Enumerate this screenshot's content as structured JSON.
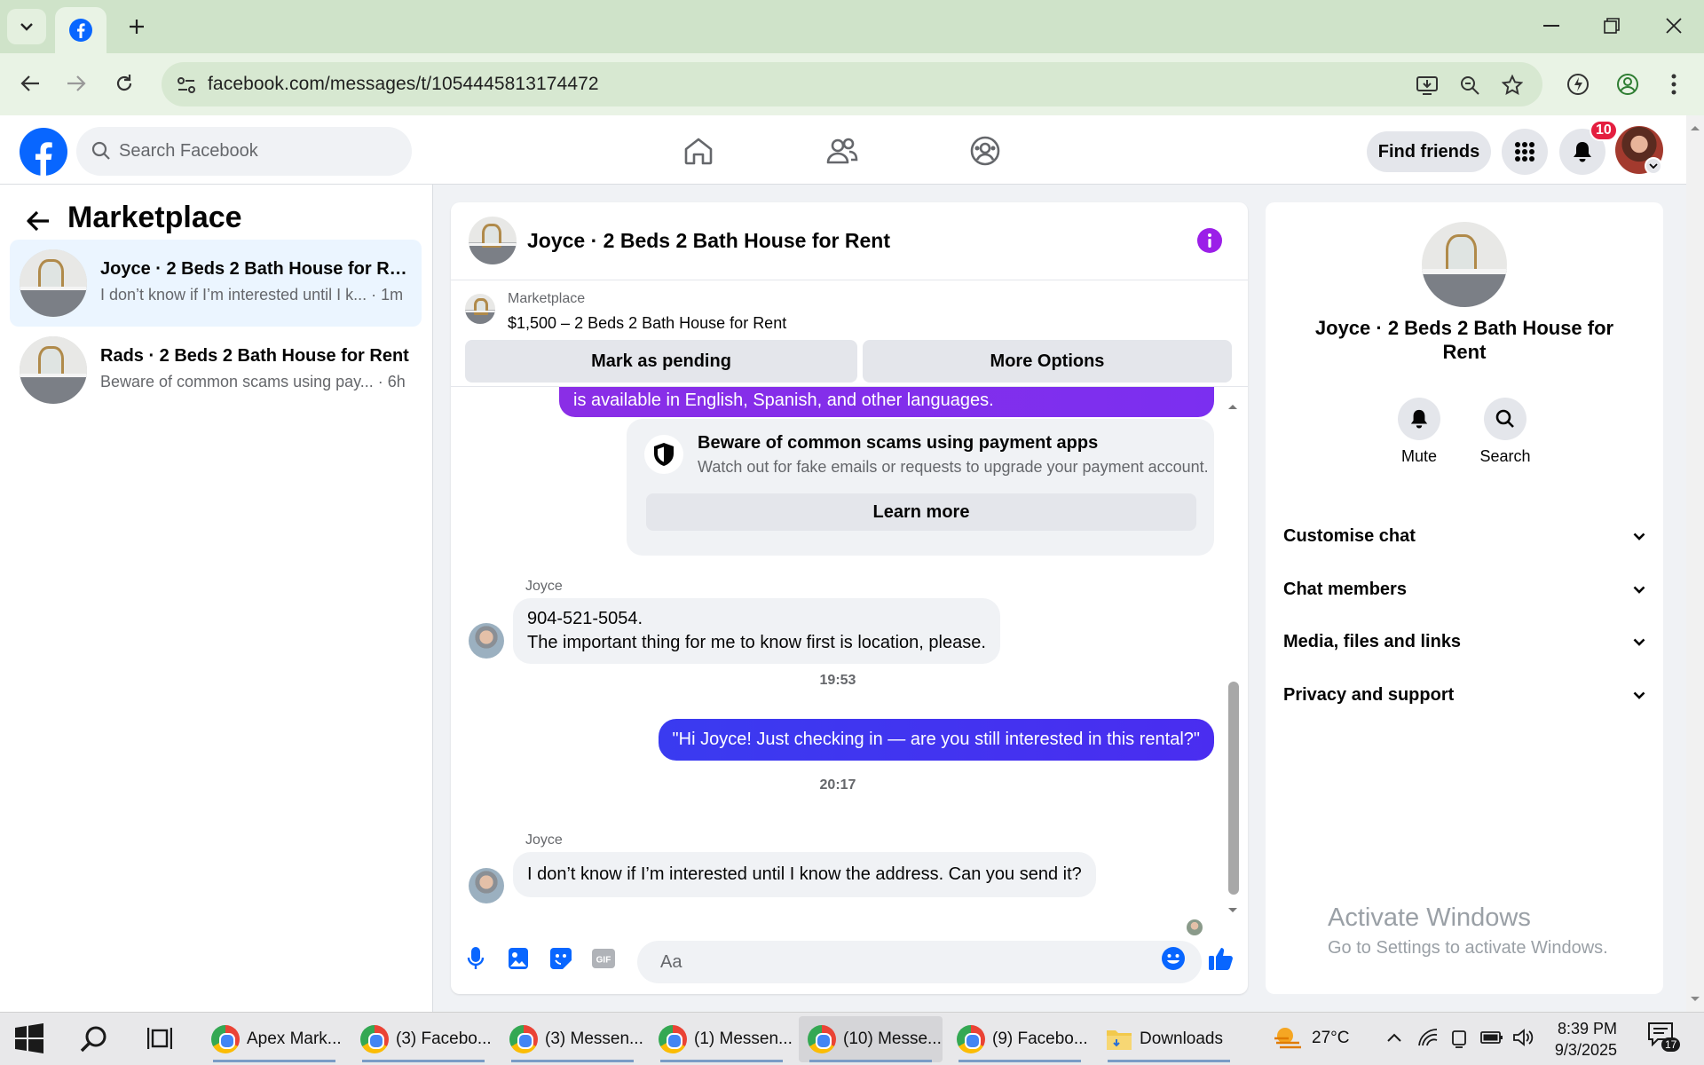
{
  "browser": {
    "url": "facebook.com/messages/t/1054445813174472"
  },
  "fb": {
    "search_placeholder": "Search Facebook",
    "find_friends": "Find friends",
    "notification_count": "10"
  },
  "sidebar": {
    "title": "Marketplace",
    "conversations": [
      {
        "name": "Joyce · 2 Beds 2 Bath House for Re...",
        "preview": "I don’t know if I’m interested until I k... · 1m",
        "active": true
      },
      {
        "name": "Rads · 2 Beds 2 Bath House for Rent",
        "preview": "Beware of common scams using pay... · 6h",
        "active": false
      }
    ]
  },
  "chat": {
    "title": "Joyce · 2 Beds 2 Bath House for Rent",
    "listing_category": "Marketplace",
    "listing_title": "$1,500 – 2 Beds 2 Bath House for Rent",
    "mark_pending": "Mark as pending",
    "more_options": "More Options",
    "purple_text": "is available in English, Spanish, and other languages.",
    "scam_title": "Beware of common scams using payment apps",
    "scam_sub": "Watch out for fake emails or requests to upgrade your payment account.",
    "learn_more": "Learn more",
    "messages": [
      {
        "sender": "Joyce",
        "line1": "904-521-5054.",
        "line2": "The important thing for me to know first is location, please."
      },
      {
        "time": "19:53"
      },
      {
        "outgoing": "\"Hi Joyce! Just checking in — are you still interested in this rental?\""
      },
      {
        "time": "20:17"
      },
      {
        "sender": "Joyce",
        "text": "I don’t know if I’m interested until I know the address. Can you send it?"
      }
    ],
    "composer_placeholder": "Aa"
  },
  "info": {
    "title": "Joyce · 2 Beds 2 Bath House for Rent",
    "mute": "Mute",
    "search": "Search",
    "sections": [
      "Customise chat",
      "Chat members",
      "Media, files and links",
      "Privacy and support"
    ],
    "watermark_1": "Activate Windows",
    "watermark_2": "Go to Settings to activate Windows."
  },
  "taskbar": {
    "apps": [
      "Apex Mark...",
      "(3) Facebo...",
      "(3) Messen...",
      "(1) Messen...",
      "(10) Messe...",
      "(9) Facebo...",
      "Downloads"
    ],
    "temperature": "27°C",
    "time": "8:39 PM",
    "date": "9/3/2025",
    "notif_count": "17"
  },
  "colors": {
    "fb_blue": "#0866ff",
    "accent_purple": "#8a2be2",
    "outgoing_blue": "#3b36f0",
    "badge_red": "#e41e3f"
  }
}
